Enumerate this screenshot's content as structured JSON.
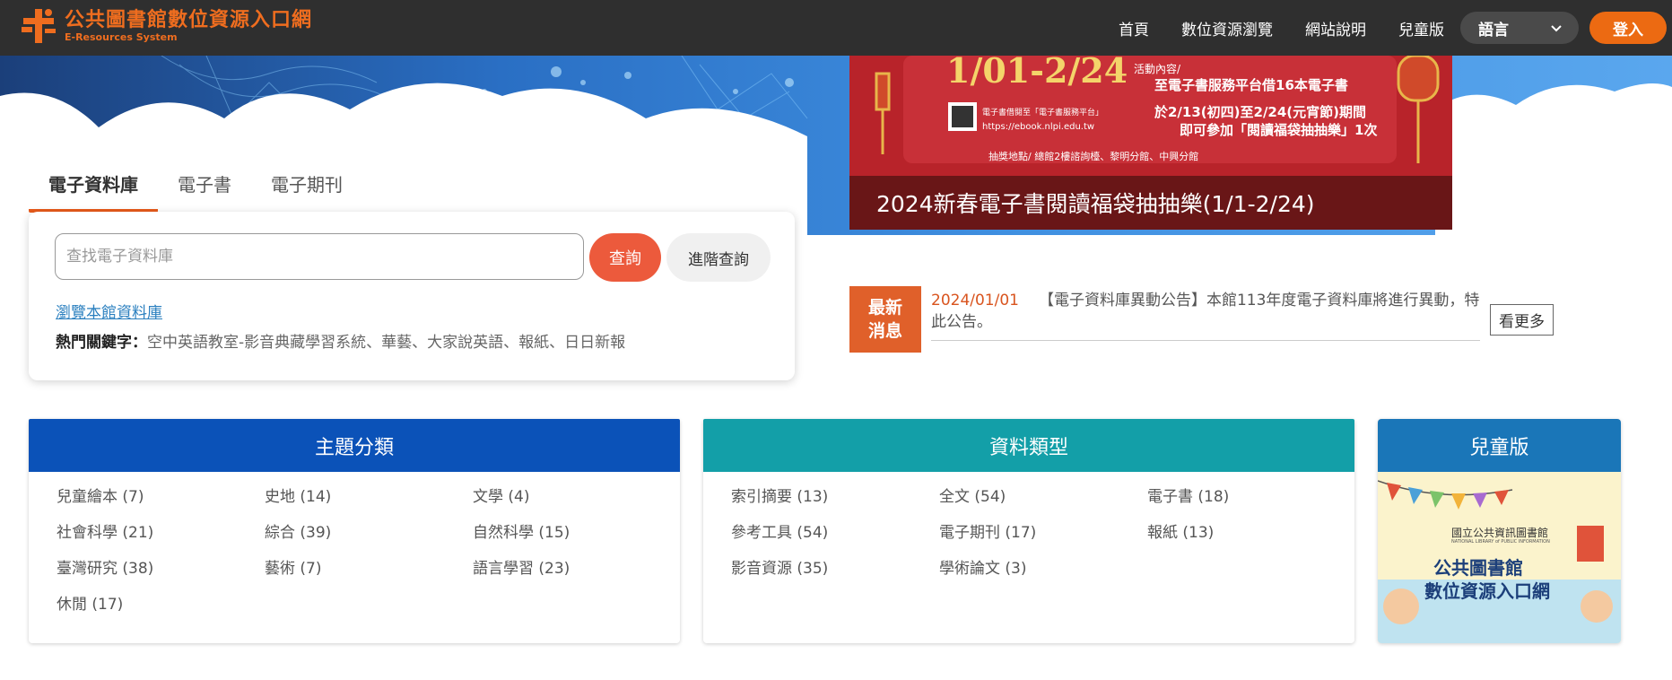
{
  "header": {
    "logo_title": "公共圖書館數位資源入口網",
    "logo_subtitle": "E-Resources System",
    "nav": [
      "首頁",
      "數位資源瀏覽",
      "網站說明",
      "兒童版"
    ],
    "language_label": "語言",
    "login_label": "登入"
  },
  "banner": {
    "date_range": "1/01-2/24",
    "activity_heading": "活動內容/",
    "line1": "至電子書服務平台借16本電子書",
    "line2": "於2/13(初四)至2/24(元宵節)期間",
    "line3": "即可參加「閱讀福袋抽抽樂」1次",
    "qr_note": "電子書借閱至「電子書服務平台」",
    "url": "https://ebook.nlpi.edu.tw",
    "location": "抽獎地點/ 總館2樓諮詢檯、黎明分館、中興分館",
    "caption": "2024新春電子書閱讀福袋抽抽樂(1/1-2/24)"
  },
  "search": {
    "tabs": [
      "電子資料庫",
      "電子書",
      "電子期刊"
    ],
    "placeholder": "查找電子資料庫",
    "search_button": "查詢",
    "advanced_button": "進階查詢",
    "browse_link": "瀏覽本館資料庫",
    "hot_label": "熱門關鍵字：",
    "hot_keywords": "空中英語教室-影音典藏學習系統、華藝、大家說英語、報紙、日日新報"
  },
  "news": {
    "badge_line1": "最新",
    "badge_line2": "消息",
    "date": "2024/01/01",
    "text": "【電子資料庫異動公告】本館113年度電子資料庫將進行異動，特此公告。",
    "more_button": "看更多"
  },
  "subjects": {
    "title": "主題分類",
    "items": [
      "兒童繪本 (7)",
      "史地 (14)",
      "文學 (4)",
      "社會科學 (21)",
      "綜合 (39)",
      "自然科學 (15)",
      "臺灣研究 (38)",
      "藝術 (7)",
      "語言學習 (23)",
      "休閒 (17)"
    ]
  },
  "types": {
    "title": "資料類型",
    "items": [
      "索引摘要 (13)",
      "全文 (54)",
      "電子書 (18)",
      "參考工具 (54)",
      "電子期刊 (17)",
      "報紙 (13)",
      "影音資源 (35)",
      "學術論文 (3)"
    ]
  },
  "kids": {
    "title": "兒童版",
    "library_name": "國立公共資訊圖書館",
    "library_en": "NATIONAL LIBRARY of PUBLIC INFORMATION",
    "line1": "公共圖書館",
    "line2": "數位資源入口網"
  },
  "colors": {
    "topbar": "#2f2f2f",
    "accent": "#ec6a12",
    "subjects_head": "#0b52b8",
    "types_head": "#139fa8",
    "kids_head": "#1a76b8"
  }
}
